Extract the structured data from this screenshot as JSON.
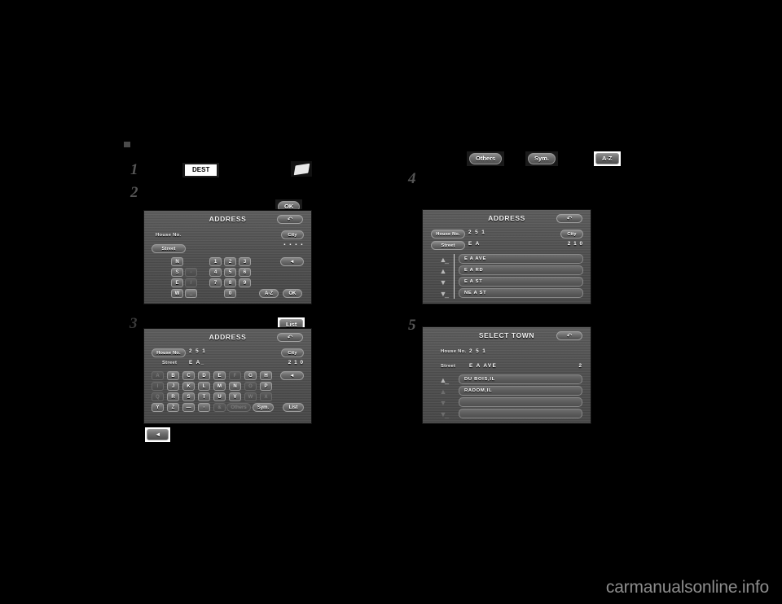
{
  "meta": {
    "watermark": "carmanualsonline.info"
  },
  "steps": {
    "one": "1",
    "two": "2",
    "three": "3",
    "four": "4",
    "five": "5"
  },
  "callouts": {
    "dest_button": "DEST",
    "map_icon": "map-card-icon",
    "ok_button": "OK",
    "list_button": "List",
    "others_button": "Others",
    "sym_button": "Sym.",
    "az_button": "A-Z",
    "back_arrow": "◄"
  },
  "screen_address_keypad": {
    "title": "ADDRESS",
    "back_icon": "↶",
    "house_no_label": "House No.",
    "house_no_value": "",
    "city_button": "City",
    "street_button": "Street",
    "street_dots": "▪ ▪ ▪ ▪",
    "backspace_icon": "◄",
    "keys_dir": [
      "N",
      "S",
      "E",
      "W"
    ],
    "keys_punct": [
      "-",
      "/",
      "⌴"
    ],
    "keys_num_rows": [
      [
        "1",
        "2",
        "3"
      ],
      [
        "4",
        "5",
        "6"
      ],
      [
        "7",
        "8",
        "9"
      ]
    ],
    "key_zero": "0",
    "az_key": "A-Z",
    "ok_key": "OK"
  },
  "screen_address_alpha": {
    "title": "ADDRESS",
    "back_icon": "↶",
    "house_no_label": "House No.",
    "house_no_value": "2 5 1",
    "city_button": "City",
    "street_label": "Street",
    "street_value": "E  A_",
    "match_count": "2 1 0",
    "backspace_icon": "◄",
    "keyrows": [
      [
        {
          "k": "A",
          "dim": true
        },
        {
          "k": "B",
          "dim": false
        },
        {
          "k": "C",
          "dim": false
        },
        {
          "k": "D",
          "dim": false
        },
        {
          "k": "E",
          "dim": false
        },
        {
          "k": "F",
          "dim": true
        },
        {
          "k": "G",
          "dim": false
        },
        {
          "k": "H",
          "dim": false
        }
      ],
      [
        {
          "k": "I",
          "dim": true
        },
        {
          "k": "J",
          "dim": false
        },
        {
          "k": "K",
          "dim": false
        },
        {
          "k": "L",
          "dim": false
        },
        {
          "k": "M",
          "dim": false
        },
        {
          "k": "N",
          "dim": false
        },
        {
          "k": "O",
          "dim": true
        },
        {
          "k": "P",
          "dim": false
        }
      ],
      [
        {
          "k": "Q",
          "dim": true
        },
        {
          "k": "R",
          "dim": false
        },
        {
          "k": "S",
          "dim": false
        },
        {
          "k": "T",
          "dim": false
        },
        {
          "k": "U",
          "dim": false
        },
        {
          "k": "V",
          "dim": false
        },
        {
          "k": "W",
          "dim": true
        },
        {
          "k": "X",
          "dim": true
        }
      ],
      [
        {
          "k": "Y",
          "dim": false
        },
        {
          "k": "Z",
          "dim": false
        },
        {
          "k": "—",
          "dim": false
        },
        {
          "k": "·",
          "dim": false
        },
        {
          "k": "&",
          "dim": true
        }
      ]
    ],
    "others_key": "Others",
    "sym_key": "Sym.",
    "list_key": "List"
  },
  "screen_address_list": {
    "title": "ADDRESS",
    "back_icon": "↶",
    "house_no_label": "House No.",
    "house_no_value": "2 5 1",
    "city_button": "City",
    "street_button": "Street",
    "street_value": "E   A",
    "match_count": "2 1 0",
    "scroll_icons": [
      "▲̲",
      "▲",
      "▼",
      "▼̲"
    ],
    "rows": [
      "E A AVE",
      "E A RD",
      "E A ST",
      "NE A ST"
    ]
  },
  "screen_select_town": {
    "title": "SELECT TOWN",
    "back_icon": "↶",
    "house_no_label": "House No.",
    "house_no_value": "2 5 1",
    "street_label": "Street",
    "street_value": "E   A   AVE",
    "match_count": "2",
    "scroll_icons": [
      "▲̲",
      "▲",
      "▼",
      "▼̲"
    ],
    "rows": [
      "DU BOIS,IL",
      "RADOM,IL",
      "",
      ""
    ]
  }
}
